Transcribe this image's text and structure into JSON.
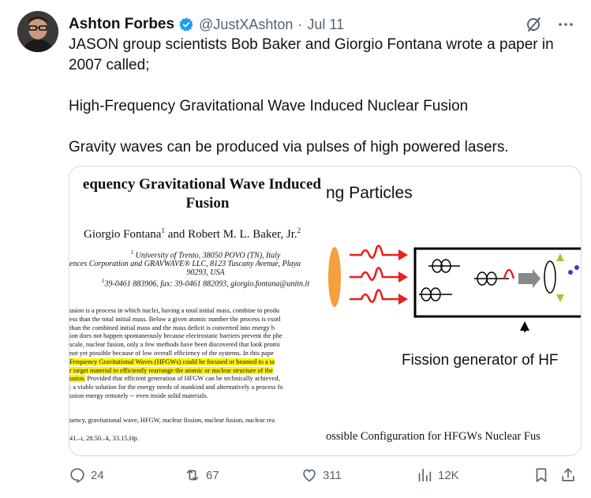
{
  "author": {
    "name": "Ashton Forbes",
    "handle": "@JustXAshton",
    "separator": "·",
    "date": "Jul 11",
    "verified_color": "#1d9bf0"
  },
  "header_icons": [
    "grok-icon",
    "more-icon"
  ],
  "tweet": {
    "line1": "JASON group scientists Bob Baker and Giorgio Fontana wrote a paper in 2007 called;",
    "line2": "High-Frequency Gravitational Wave Induced Nuclear Fusion",
    "line3": "Gravity waves can be produced via pulses of high powered lasers."
  },
  "paper": {
    "title_line1": "equency Gravitational Wave Induced",
    "title_line2": "Fusion",
    "authors": "Giorgio Fontana",
    "authors_sup1": "1",
    "authors_and": " and Robert M. L. Baker, Jr.",
    "authors_sup2": "2",
    "affil_1_sup": "1",
    "affil_1": " University of Trento, 38050 POVO (TN), Italy",
    "affil_2": "ences Corporation and GRAVWAVE® LLC, 8123 Tuscany Avenue, Playa",
    "affil_3": "90293, USA",
    "affil_4_sup": "1",
    "affil_4": "39-0461 883906, fax: 39-0461 882093, giorgio.fontana@unitn.it",
    "abstract_lines": [
      "usion is a process in which nuclei, having a total initial mass, combine to produ",
      "ess than the total initial mass. Below a given atomic number the process is exotl",
      " than the combined initial mass and the mass deficit is converted into energy b",
      "ion does not happen spontaneously because electrostatic barriers prevent the phe",
      " scale, nuclear fusion, only a few methods have been discovered that look promi",
      " not yet possible because of low overall efficiency of the systems. In this pape"
    ],
    "abstract_highlight_lines": [
      "Frequency Gravitational Waves (HFGWs) could be focused or beamed to a ta",
      "r target material to efficiently rearrange the atomic or nuclear structure of the"
    ],
    "abstract_highlight_partial": "usion.",
    "abstract_after_partial": " Provided that efficient generation of HFGW can be technically achieved,",
    "abstract_tail_lines": [
      ": a viable solution for the energy needs of mankind and alternatively a process fo",
      "usion energy remotely -- even inside solid materials."
    ],
    "keywords": "uency, gravitational wave, HFGW, nuclear fission,  nuclear fusion, nuclear rea",
    "pacs": "41.–i, 28.50.–k, 33.15.Hp."
  },
  "figure": {
    "top_text": "ng Particles",
    "label": "Fission generator of HF",
    "caption": "ossible Configuration for HFGWs Nuclear Fus"
  },
  "actions": {
    "reply_count": "24",
    "retweet_count": "67",
    "like_count": "311",
    "views_count": "12K"
  }
}
